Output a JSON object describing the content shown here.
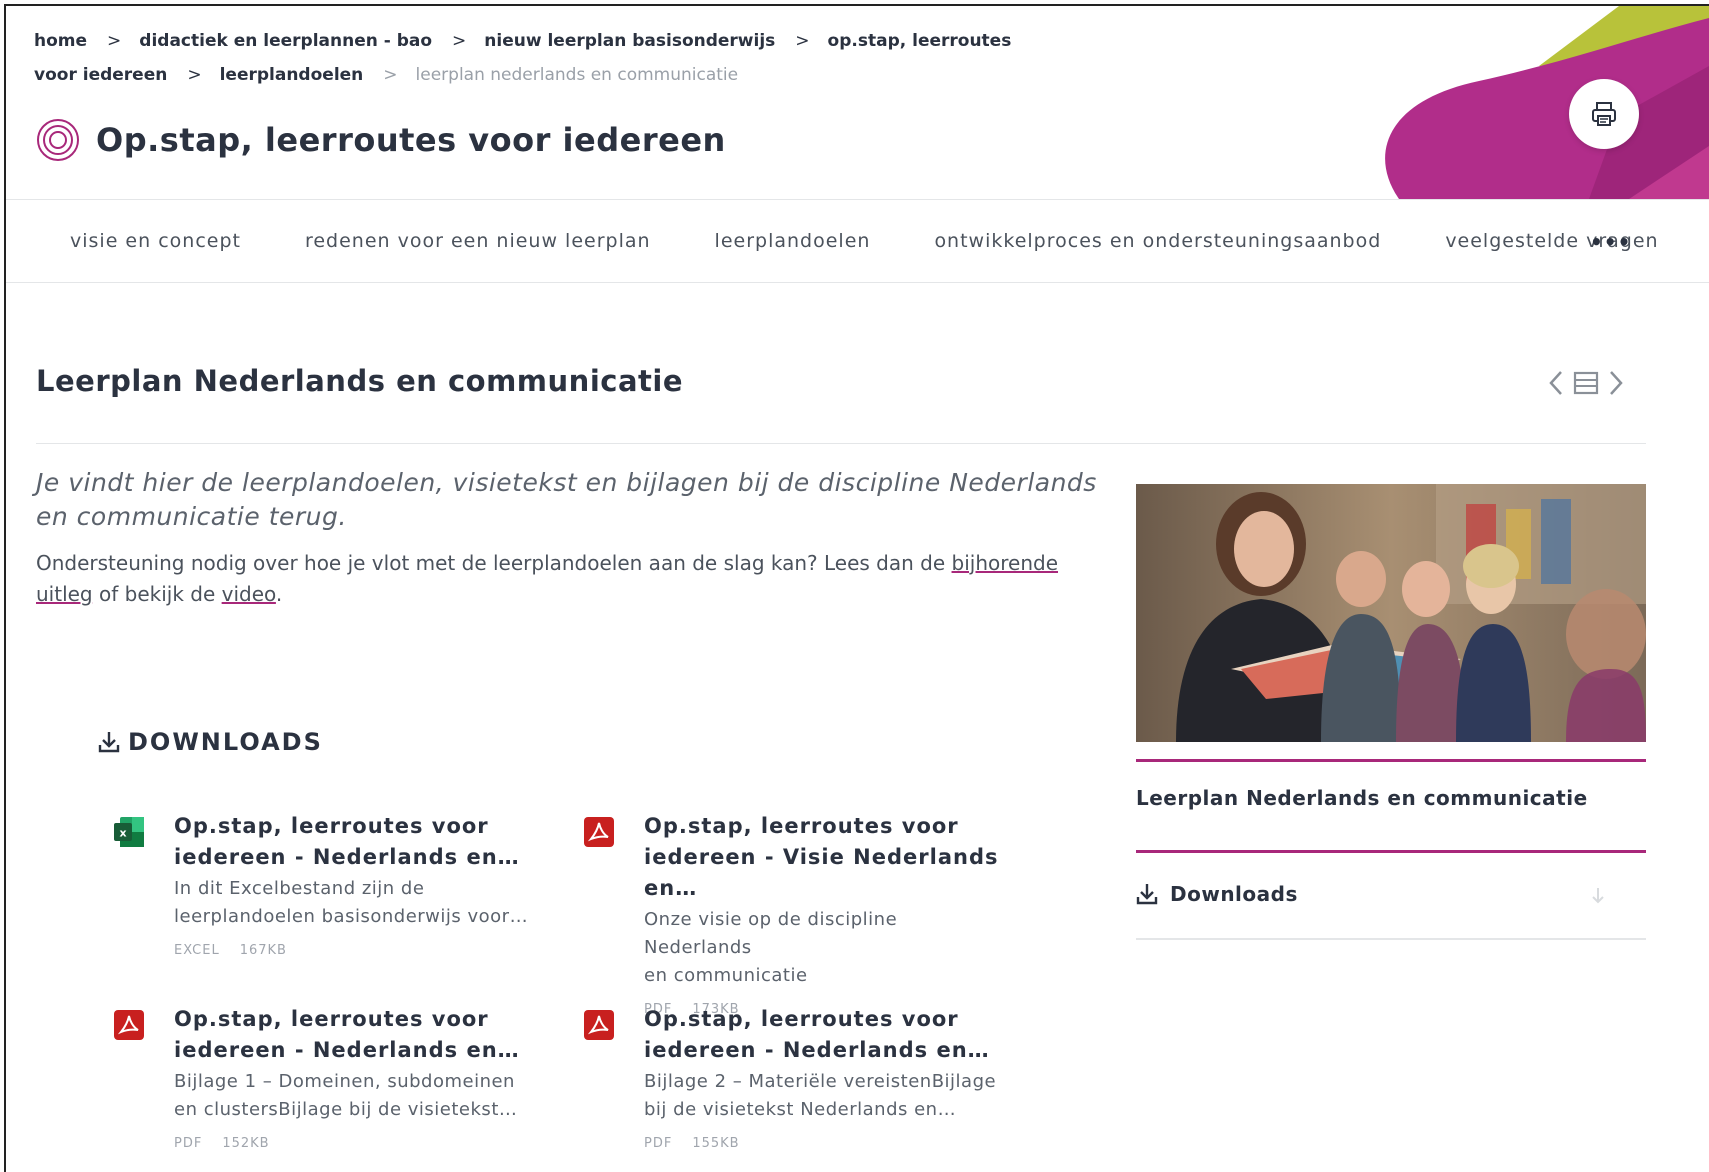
{
  "breadcrumb": {
    "items": [
      "home",
      "didactiek en leerplannen - bao",
      "nieuw leerplan basisonderwijs",
      "op.stap, leerroutes voor iedereen",
      "leerplandoelen"
    ],
    "current": "leerplan nederlands en communicatie"
  },
  "header": {
    "title": "Op.stap, leerroutes voor iedereen",
    "print_icon": "printer-icon",
    "title_icon": "target-icon"
  },
  "nav": {
    "items": [
      "visie en concept",
      "redenen voor een nieuw leerplan",
      "leerplandoelen",
      "ontwikkelproces en ondersteuningsaanbod",
      "veelgestelde vragen"
    ],
    "more": "•••"
  },
  "section": {
    "title": "Leerplan Nederlands en communicatie",
    "intro": "Je vindt hier de leerplandoelen, visietekst en bijlagen bij de discipline Nederlands en communicatie terug.",
    "body_prefix": "Ondersteuning nodig over hoe je vlot met de leerplandoelen aan de slag kan? Lees dan de ",
    "body_link1": "bijhorende uitleg",
    "body_mid": " of bekijk de ",
    "body_link2": "video",
    "body_suffix": "."
  },
  "downloads": {
    "heading": "DOWNLOADS",
    "items": [
      {
        "title1": "Op.stap, leerroutes voor",
        "title2": "iedereen - Nederlands en…",
        "desc1": "In dit Excelbestand zijn de",
        "desc2": "leerplandoelen basisonderwijs voor…",
        "type": "EXCEL",
        "size": "167KB",
        "icon": "excel-icon"
      },
      {
        "title1": "Op.stap, leerroutes voor",
        "title2": "iedereen - Visie Nederlands en…",
        "desc1": "Onze visie op de discipline Nederlands",
        "desc2": "en communicatie",
        "type": "PDF",
        "size": "173KB",
        "icon": "pdf-icon"
      },
      {
        "title1": "Op.stap, leerroutes voor",
        "title2": "iedereen - Nederlands en…",
        "desc1": "Bijlage 1 – Domeinen, subdomeinen",
        "desc2": "en clustersBijlage bij de visietekst…",
        "type": "PDF",
        "size": "152KB",
        "icon": "pdf-icon"
      },
      {
        "title1": "Op.stap, leerroutes voor",
        "title2": "iedereen - Nederlands en…",
        "desc1": "Bijlage 2 – Materiële vereistenBijlage",
        "desc2": "bij de visietekst Nederlands en…",
        "type": "PDF",
        "size": "155KB",
        "icon": "pdf-icon"
      }
    ]
  },
  "sidebar": {
    "link": "Leerplan Nederlands en communicatie",
    "downloads": "Downloads"
  },
  "colors": {
    "accent": "#a8287a",
    "text": "#2b3240",
    "excel": "#1f7a45",
    "pdf": "#c8201f"
  }
}
